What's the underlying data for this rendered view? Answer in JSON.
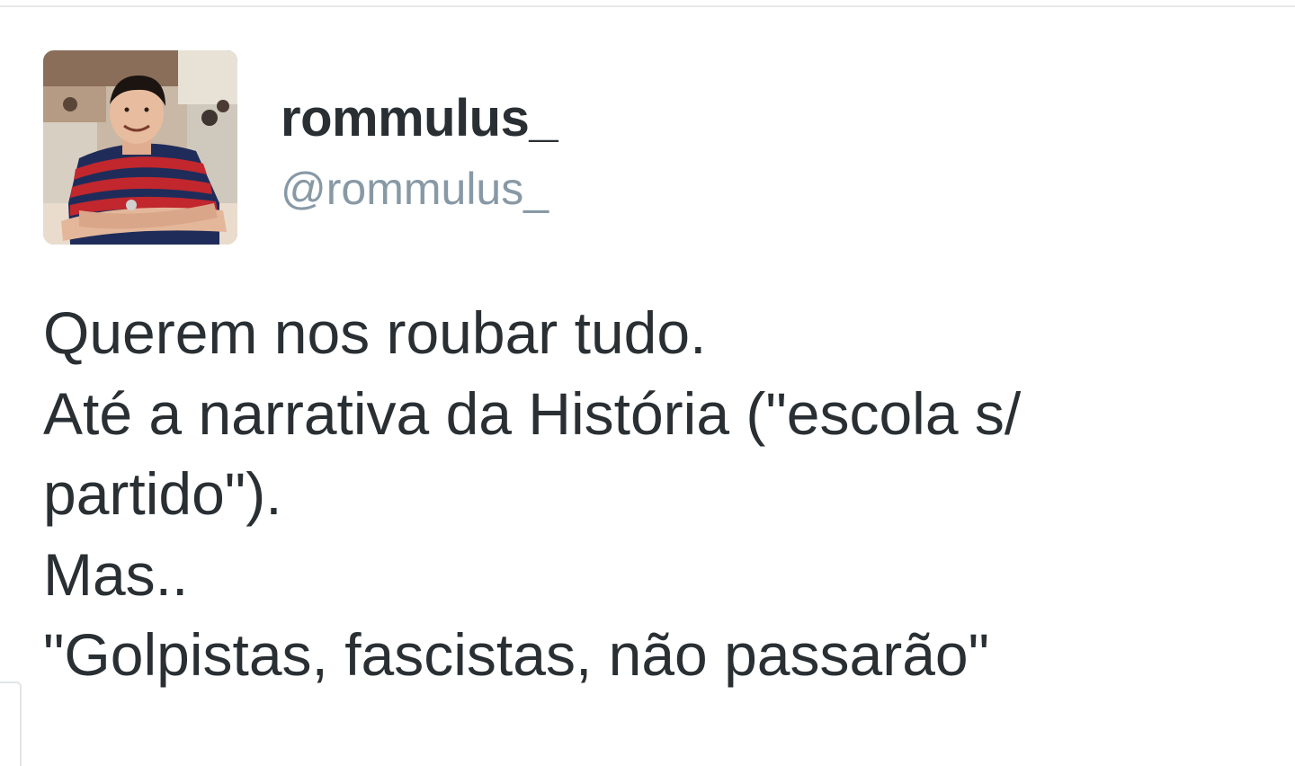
{
  "tweet": {
    "user": {
      "display_name": "rommulus_",
      "handle": "@rommulus_",
      "avatar": "profile-photo"
    },
    "text_lines": [
      "Querem nos roubar tudo.",
      "Até a narrativa da História (\"escola s/",
      "partido\").",
      "Mas..",
      "\"Golpistas, fascistas, não passarão\""
    ]
  },
  "colors": {
    "name": "#292f33",
    "handle": "#8899a6",
    "text": "#292f33",
    "divider": "#e6e8ea"
  }
}
